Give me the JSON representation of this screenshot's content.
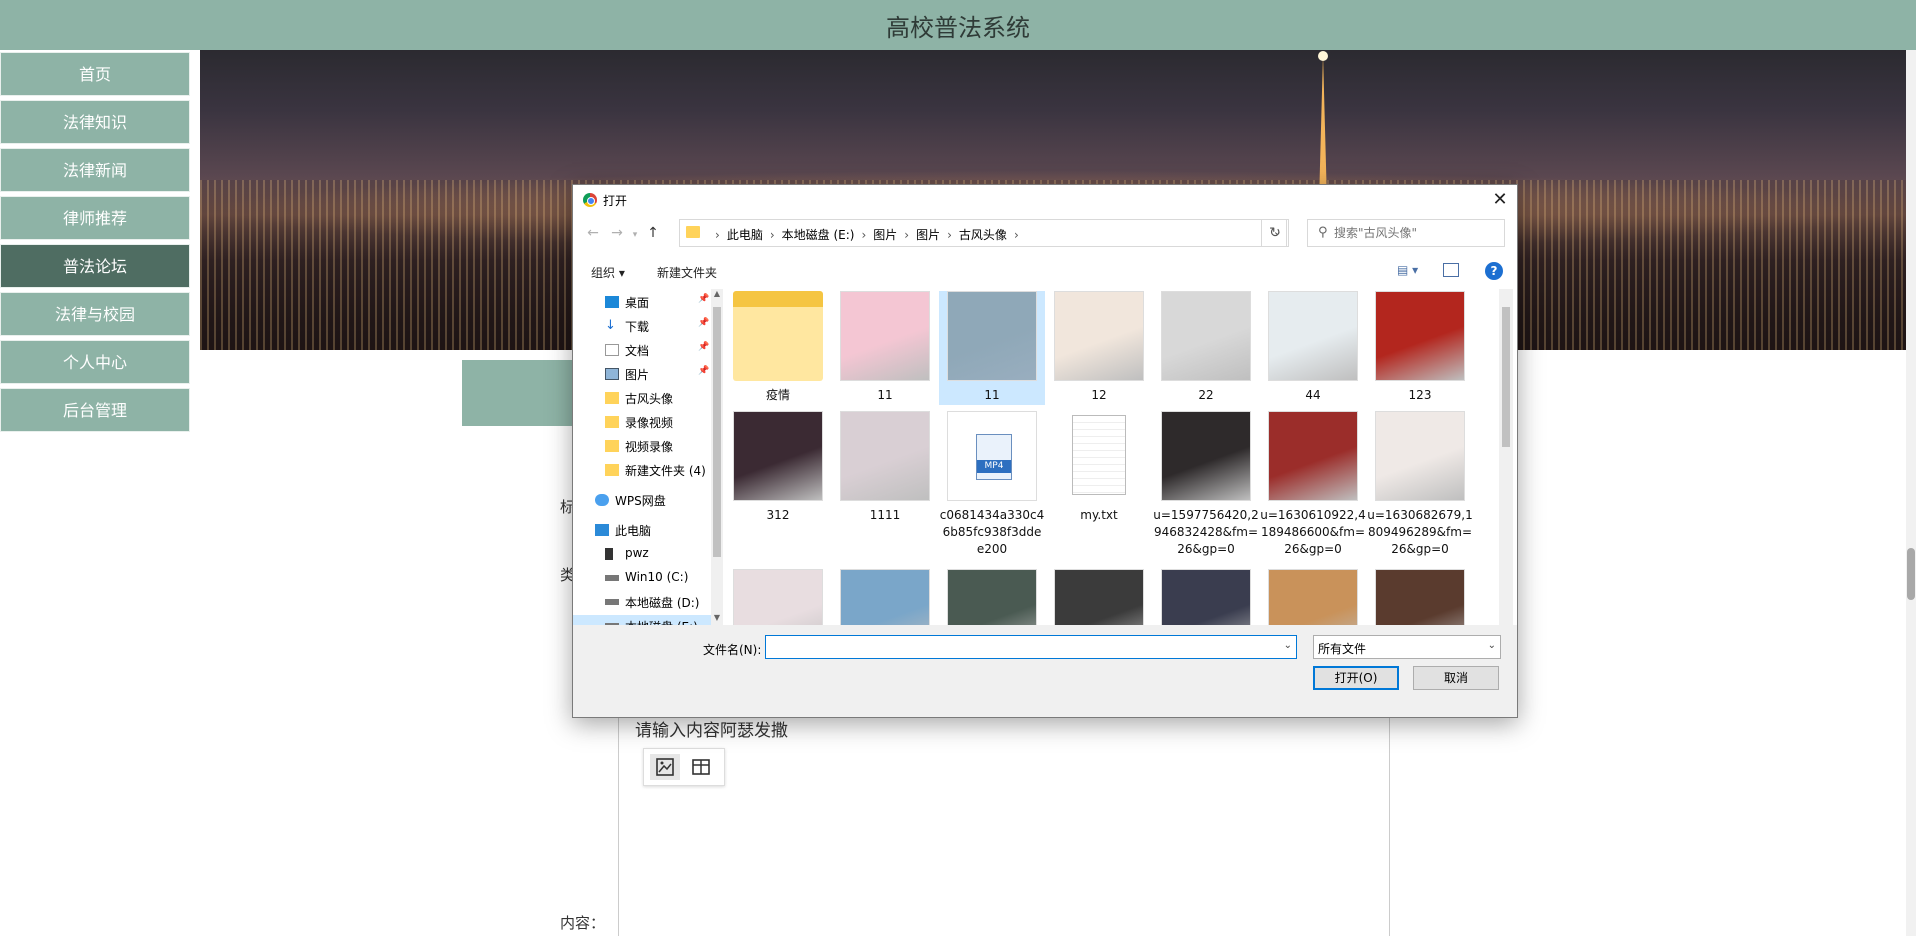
{
  "site": {
    "title": "高校普法系统"
  },
  "sidebar": {
    "items": [
      {
        "label": "首页"
      },
      {
        "label": "法律知识"
      },
      {
        "label": "法律新闻"
      },
      {
        "label": "律师推荐"
      },
      {
        "label": "普法论坛"
      },
      {
        "label": "法律与校园"
      },
      {
        "label": "个人中心"
      },
      {
        "label": "后台管理"
      }
    ]
  },
  "form": {
    "label_partial_1": "标",
    "label_partial_2": "类",
    "content_label": "内容：",
    "editor_text": "请输入内容阿瑟发撒"
  },
  "dialog": {
    "title": "打开",
    "close_glyph": "✕",
    "breadcrumb": [
      "此电脑",
      "本地磁盘 (E:)",
      "图片",
      "图片",
      "古风头像"
    ],
    "search_placeholder": "搜索\"古风头像\"",
    "toolbar": {
      "organize": "组织 ▾",
      "new_folder": "新建文件夹"
    },
    "tree": [
      {
        "label": "桌面",
        "icon": "desktop-icon",
        "pinned": true
      },
      {
        "label": "下载",
        "icon": "download-icon",
        "pinned": true
      },
      {
        "label": "文档",
        "icon": "document-icon",
        "pinned": true
      },
      {
        "label": "图片",
        "icon": "pictures-icon",
        "pinned": true
      },
      {
        "label": "古风头像",
        "icon": "folder-icon",
        "pinned": false
      },
      {
        "label": "录像视频",
        "icon": "folder-icon",
        "pinned": false
      },
      {
        "label": "视频录像",
        "icon": "folder-icon",
        "pinned": false
      },
      {
        "label": "新建文件夹 (4)",
        "icon": "folder-icon",
        "pinned": false
      },
      {
        "label": "WPS网盘",
        "icon": "cloud-icon",
        "pinned": false
      },
      {
        "label": "此电脑",
        "icon": "computer-icon",
        "pinned": false
      },
      {
        "label": "pwz",
        "icon": "phone-icon",
        "pinned": false
      },
      {
        "label": "Win10 (C:)",
        "icon": "drive-icon",
        "pinned": false
      },
      {
        "label": "本地磁盘 (D:)",
        "icon": "drive-icon",
        "pinned": false
      },
      {
        "label": "本地磁盘 (E:)",
        "icon": "drive-icon",
        "pinned": false
      }
    ],
    "files": [
      {
        "name": "疫情",
        "kind": "folder"
      },
      {
        "name": "11",
        "kind": "image",
        "color": "#f4c6d3"
      },
      {
        "name": "11",
        "kind": "image",
        "color": "#8fa8b8",
        "selected": true
      },
      {
        "name": "12",
        "kind": "image",
        "color": "#f1e6dc"
      },
      {
        "name": "22",
        "kind": "image",
        "color": "#d8d8d8"
      },
      {
        "name": "44",
        "kind": "image",
        "color": "#e6ecef"
      },
      {
        "name": "123",
        "kind": "image",
        "color": "#b3261e"
      },
      {
        "name": "312",
        "kind": "image",
        "color": "#3b2a33"
      },
      {
        "name": "1111",
        "kind": "image",
        "color": "#d9cfd4"
      },
      {
        "name": "c0681434a330c46b85fc938f3ddee200",
        "kind": "mp4"
      },
      {
        "name": "my.txt",
        "kind": "txt"
      },
      {
        "name": "u=1597756420,2946832428&fm=26&gp=0",
        "kind": "image",
        "color": "#2e2a2b"
      },
      {
        "name": "u=1630610922,4189486600&fm=26&gp=0",
        "kind": "image",
        "color": "#9b2d2a"
      },
      {
        "name": "u=1630682679,1809496289&fm=26&gp=0",
        "kind": "image",
        "color": "#efe9e6"
      },
      {
        "name": "",
        "kind": "image",
        "color": "#e8dde0"
      },
      {
        "name": "",
        "kind": "image",
        "color": "#7aa6c9"
      },
      {
        "name": "",
        "kind": "image",
        "color": "#4a5a52"
      },
      {
        "name": "",
        "kind": "image",
        "color": "#3b3b3b"
      },
      {
        "name": "",
        "kind": "image",
        "color": "#3a3d4f"
      },
      {
        "name": "",
        "kind": "image",
        "color": "#c9925a"
      },
      {
        "name": "",
        "kind": "image",
        "color": "#5a3b2e"
      }
    ],
    "filename_label": "文件名(N):",
    "filename_value": "",
    "filetype_value": "所有文件",
    "open_button": "打开(O)",
    "cancel_button": "取消"
  }
}
